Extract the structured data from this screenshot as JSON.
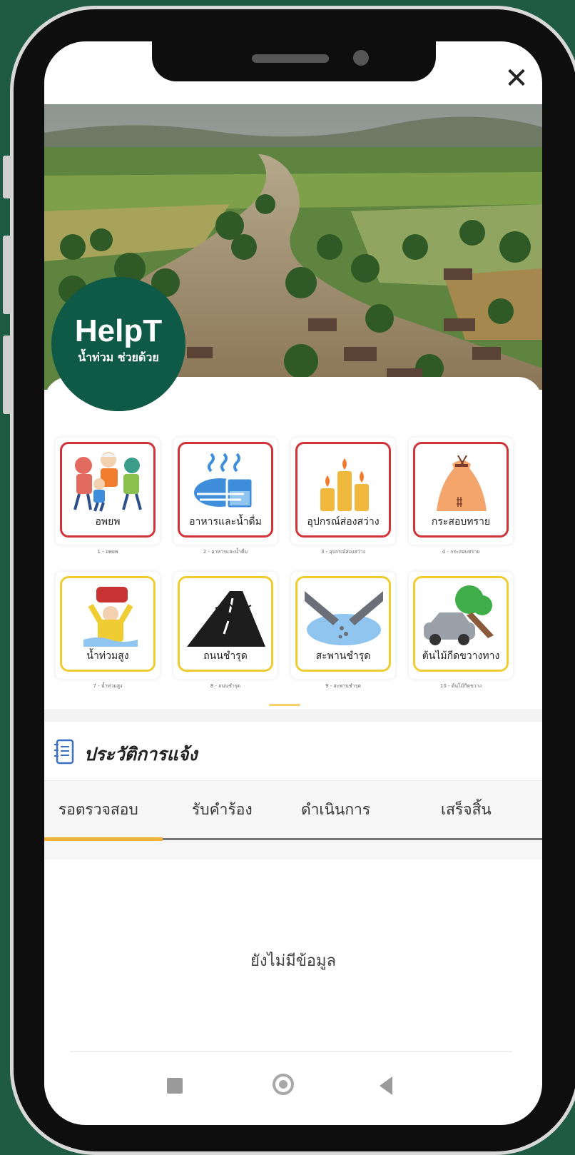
{
  "window": {
    "close_glyph": "✕"
  },
  "brand": {
    "title": "HelpT",
    "subtitle": "น้ำท่วม ช่วยด้วย",
    "color": "#0f5a46"
  },
  "categories": [
    {
      "label": "อพยพ",
      "caption": "1 - อพยพ",
      "border": "red",
      "icon": "evacuation-icon"
    },
    {
      "label": "อาหารและน้ำดื่ม",
      "caption": "2 - อาหารและน้ำดื่ม",
      "border": "red",
      "icon": "food-water-icon"
    },
    {
      "label": "อุปกรณ์ส่องสว่าง",
      "caption": "3 - อุปกรณ์ส่องสว่าง",
      "border": "red",
      "icon": "candles-icon"
    },
    {
      "label": "กระสอบทราย",
      "caption": "4 - กระสอบทราย",
      "border": "red",
      "icon": "sandbag-icon"
    },
    {
      "label": "น้ำท่วมสูง",
      "caption": "7 - น้ำท่วมสูง",
      "border": "yellow",
      "icon": "high-flood-icon"
    },
    {
      "label": "ถนนชำรุด",
      "caption": "8 - ถนนชำรุด",
      "border": "yellow",
      "icon": "damaged-road-icon"
    },
    {
      "label": "สะพานชำรุด",
      "caption": "9 - สะพานชำรุด",
      "border": "yellow",
      "icon": "damaged-bridge-icon"
    },
    {
      "label": "ต้นไม้กีดขวางทาง",
      "caption": "10 - ต้นไม้กีดขวาง",
      "border": "yellow",
      "icon": "fallen-tree-icon"
    }
  ],
  "history": {
    "title": "ประวัติการแจ้ง",
    "tabs": [
      "รอตรวจสอบ",
      "รับคำร้อง",
      "ดำเนินการ",
      "เสร็จสิ้น"
    ],
    "active_tab": 0,
    "empty_text": "ยังไม่มีข้อมูล"
  },
  "colors": {
    "accent": "#f4b23a",
    "danger": "#d0343a",
    "warning": "#f0cc33",
    "background": "#1f5a45"
  }
}
